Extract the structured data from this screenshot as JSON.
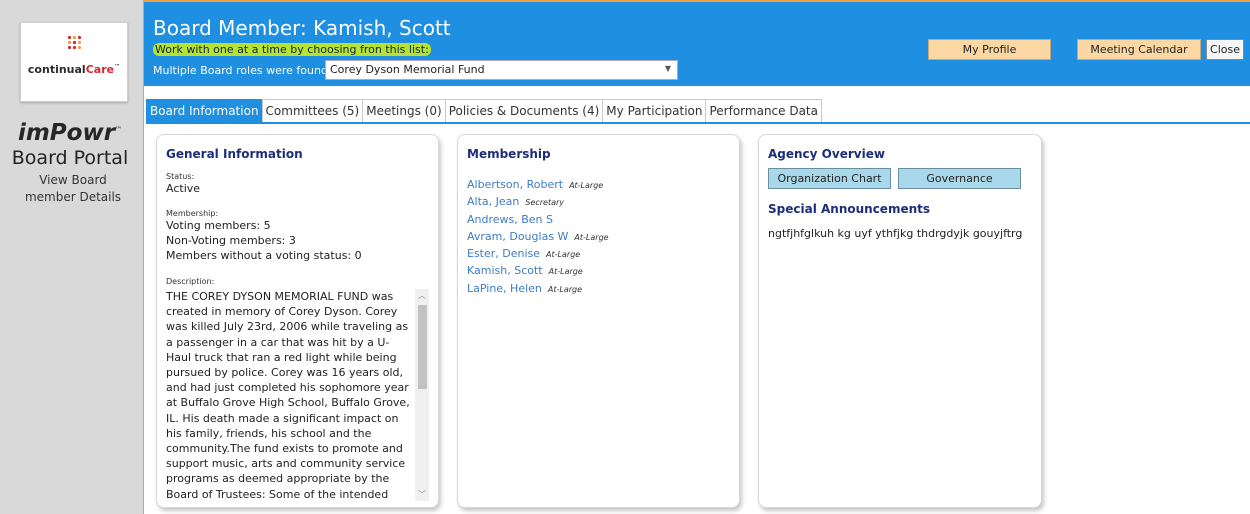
{
  "sidebar": {
    "logo": {
      "brand_main": "continual",
      "brand_accent": "Care",
      "tm": "™"
    },
    "product": "imPowr",
    "product_tm": "™",
    "portal_title": "Board Portal",
    "portal_subtitle": "View Board member Details"
  },
  "header": {
    "title": "Board Member: Kamish, Scott",
    "hint": "Work with one at a time by choosing fron this list:",
    "roles_label": "Multiple Board roles were found.",
    "role_selected": "Corey Dyson Memorial Fund",
    "buttons": {
      "profile": "My Profile",
      "calendar": "Meeting Calendar",
      "close": "Close"
    }
  },
  "tabs": [
    {
      "label": "Board Information",
      "active": true
    },
    {
      "label": "Committees (5)",
      "active": false
    },
    {
      "label": "Meetings (0)",
      "active": false
    },
    {
      "label": "Policies & Documents (4)",
      "active": false
    },
    {
      "label": "My Participation",
      "active": false
    },
    {
      "label": "Performance Data",
      "active": false
    }
  ],
  "general": {
    "heading": "General Information",
    "status_label": "Status:",
    "status_value": "Active",
    "membership_label": "Membership:",
    "voting": "Voting members: 5",
    "non_voting": "Non-Voting members: 3",
    "without_status": "Members without a voting status: 0",
    "description_label": "Description:",
    "description": "THE COREY DYSON MEMORIAL FUND was created in memory of Corey Dyson. Corey was killed July 23rd, 2006 while traveling as a passenger in a car that was hit by a U-Haul truck that ran a red light while being pursued by police. Corey was 16 years old, and had just completed his sophomore year at Buffalo Grove High School, Buffalo Grove, IL. His death made a significant impact on his family, friends, his school and the community.The fund exists to promote and support music, arts and community service programs as deemed appropriate by the Board of Trustees: Some of the intended programs include: Music"
  },
  "membership": {
    "heading": "Membership",
    "members": [
      {
        "name": "Albertson, Robert",
        "role": "At-Large"
      },
      {
        "name": "Alta, Jean",
        "role": "Secretary"
      },
      {
        "name": "Andrews, Ben S",
        "role": ""
      },
      {
        "name": "Avram, Douglas W",
        "role": "At-Large"
      },
      {
        "name": "Ester, Denise",
        "role": "At-Large"
      },
      {
        "name": "Kamish, Scott",
        "role": "At-Large"
      },
      {
        "name": "LaPine, Helen",
        "role": "At-Large"
      }
    ]
  },
  "agency": {
    "heading": "Agency Overview",
    "org_chart": "Organization Chart",
    "governance": "Governance",
    "announcements_heading": "Special Announcements",
    "announcement": "ngtfjhfglkuh kg uyf ythfjkg thdrgdyjk gouyjftrg"
  },
  "colors": {
    "header_blue": "#1e8fe1",
    "accent_orange": "#f0a040",
    "button_peach": "#fbd7a4",
    "link_blue": "#3d7cc4",
    "heading_navy": "#1d2d7a",
    "highlight": "#c0e628"
  }
}
